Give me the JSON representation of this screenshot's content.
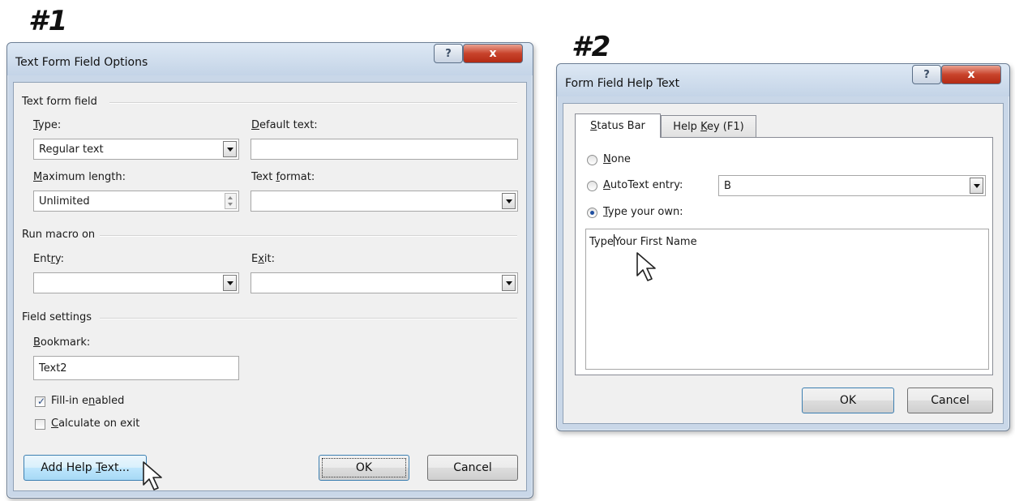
{
  "labels": {
    "first": "#1",
    "second": "#2"
  },
  "dialog1": {
    "title": "Text Form Field Options",
    "help_glyph": "?",
    "close_glyph": "x",
    "section_text_form_field": "Text form field",
    "type_label": "Type:",
    "type_value": "Regular text",
    "default_text_label": "Default text:",
    "default_text_value": "",
    "max_length_label": "Maximum length:",
    "max_length_value": "Unlimited",
    "text_format_label": "Text format:",
    "text_format_value": "",
    "section_run_macro": "Run macro on",
    "entry_label": "Entry:",
    "entry_value": "",
    "exit_label": "Exit:",
    "exit_value": "",
    "section_field_settings": "Field settings",
    "bookmark_label": "Bookmark:",
    "bookmark_value": "Text2",
    "fill_in_label": "Fill-in enabled",
    "fill_in_checked": true,
    "calculate_label": "Calculate on exit",
    "calculate_checked": false,
    "add_help_button": "Add Help Text...",
    "ok_button": "OK",
    "cancel_button": "Cancel"
  },
  "dialog2": {
    "title": "Form Field Help Text",
    "help_glyph": "?",
    "close_glyph": "x",
    "tabs": [
      {
        "label": "Status Bar",
        "active": true
      },
      {
        "label": "Help Key (F1)",
        "active": false
      }
    ],
    "radio_none": "None",
    "radio_autotext": "AutoText entry:",
    "autotext_value": "B",
    "radio_type_own": "Type your own:",
    "selected_radio": "Type your own:",
    "text_area_before_caret": "Type",
    "text_area_after_caret": "Your First Name",
    "ok_button": "OK",
    "cancel_button": "Cancel"
  },
  "icons": [
    "mouse-pointer-icon",
    "dropdown-arrow-icon",
    "checkmark-icon",
    "spinner-icon"
  ],
  "colors": {
    "title_gradient_top": "#dde8f4",
    "close_red": "#c8432b",
    "dialog_bg": "#f0f0f0",
    "radio_blue": "#1f4fa0"
  }
}
